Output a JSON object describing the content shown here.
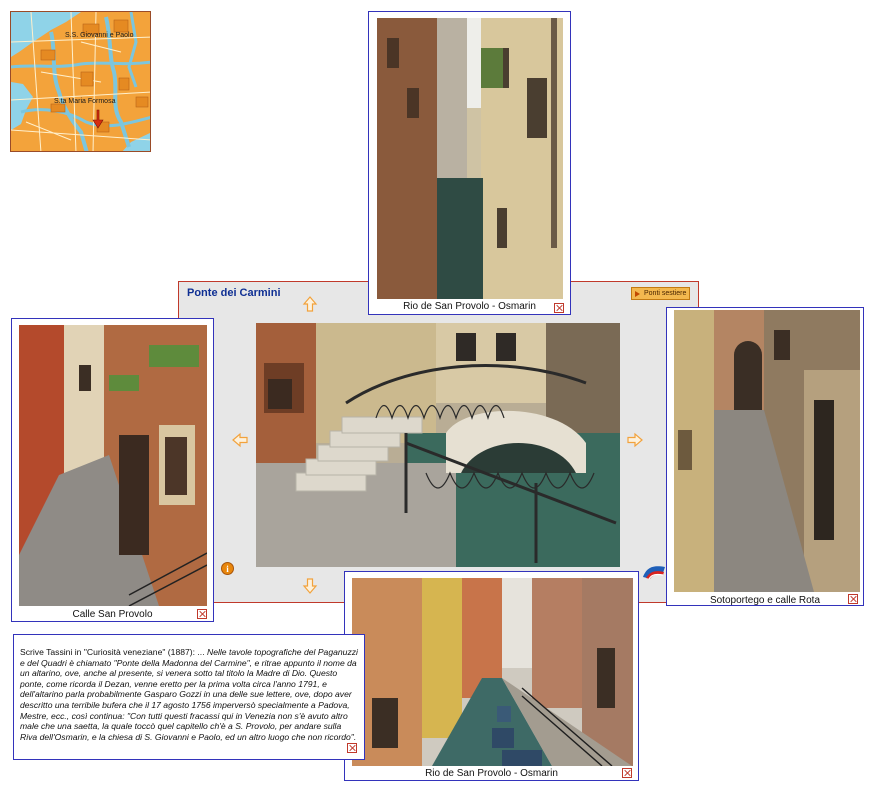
{
  "map": {
    "labels": {
      "giovanni_paolo": "S.S. Giovanni e Paolo",
      "maria_formosa": "S.ta Maria Formosa"
    }
  },
  "panel": {
    "title": "Ponte dei Carmini",
    "sestiere_button": "Ponti sestiere"
  },
  "photos": {
    "top": {
      "caption": "Rio de San Provolo - Osmarin"
    },
    "left": {
      "caption": "Calle San Provolo"
    },
    "right": {
      "caption": "Sotoportego e calle Rota"
    },
    "bottom": {
      "caption": "Rio de San Provolo - Osmarin"
    }
  },
  "text": {
    "intro": "Scrive Tassini in \"Curiosità veneziane\" (1887): ... ",
    "quote": "Nelle tavole topografiche del Paganuzzi e del Quadri è chiamato \"Ponte della Madonna del Carmine\", e ritrae appunto il nome da un altarino, ove, anche al presente, si venera sotto tal titolo la Madre di Dio. Questo ponte, come ricorda il Dezan, venne eretto per la prima volta circa l'anno 1791, e dell'altarino parla probabilmente Gasparo Gozzi in una delle sue lettere, ove, dopo aver descritto una terribile bufera che il 17 agosto 1756 imperversò specialmente a Padova, Mestre, ecc., così continua: \"Con tutti questi fracassi qui in Venezia non s'è avuto altro male che una saetta, la quale toccò quel capitello ch'è a S. Provolo, per andare sulla Riva dell'Osmarin, e la chiesa di S. Giovanni e Paolo, ed un altro luogo che non ricordo\"."
  },
  "icons": {
    "info": "i",
    "arrows": [
      "arrow-up-icon",
      "arrow-left-icon",
      "arrow-right-icon",
      "arrow-down-icon"
    ],
    "flag": "venice-flag-icon"
  },
  "colors": {
    "title": "#0f2f93",
    "frame_border": "#3333bb",
    "panel_border": "#c0392b",
    "panel_bg": "#e7e7e7",
    "arrow": "#f2a23c",
    "button": "#f3b84f"
  }
}
